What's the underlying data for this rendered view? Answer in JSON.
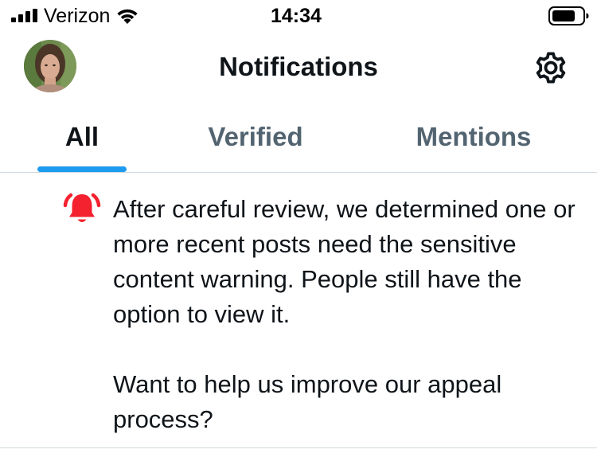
{
  "status_bar": {
    "carrier": "Verizon",
    "time": "14:34",
    "icons": [
      "signal-bars-icon",
      "wifi-icon",
      "battery-icon"
    ]
  },
  "header": {
    "title": "Notifications",
    "settings_icon": "gear-icon"
  },
  "tabs": [
    {
      "label": "All",
      "active": true
    },
    {
      "label": "Verified",
      "active": false
    },
    {
      "label": "Mentions",
      "active": false
    }
  ],
  "notification": {
    "icon": "bell-icon",
    "paragraphs": [
      "After careful review, we determined one or more recent posts need the sensitive content warning. People still have the option to view it.",
      "Want to help us improve our appeal process?"
    ]
  },
  "colors": {
    "accent": "#1d9bf0",
    "bell": "#f4212e",
    "text_primary": "#0f1419",
    "text_secondary": "#536471",
    "divider": "#cfd9de"
  }
}
